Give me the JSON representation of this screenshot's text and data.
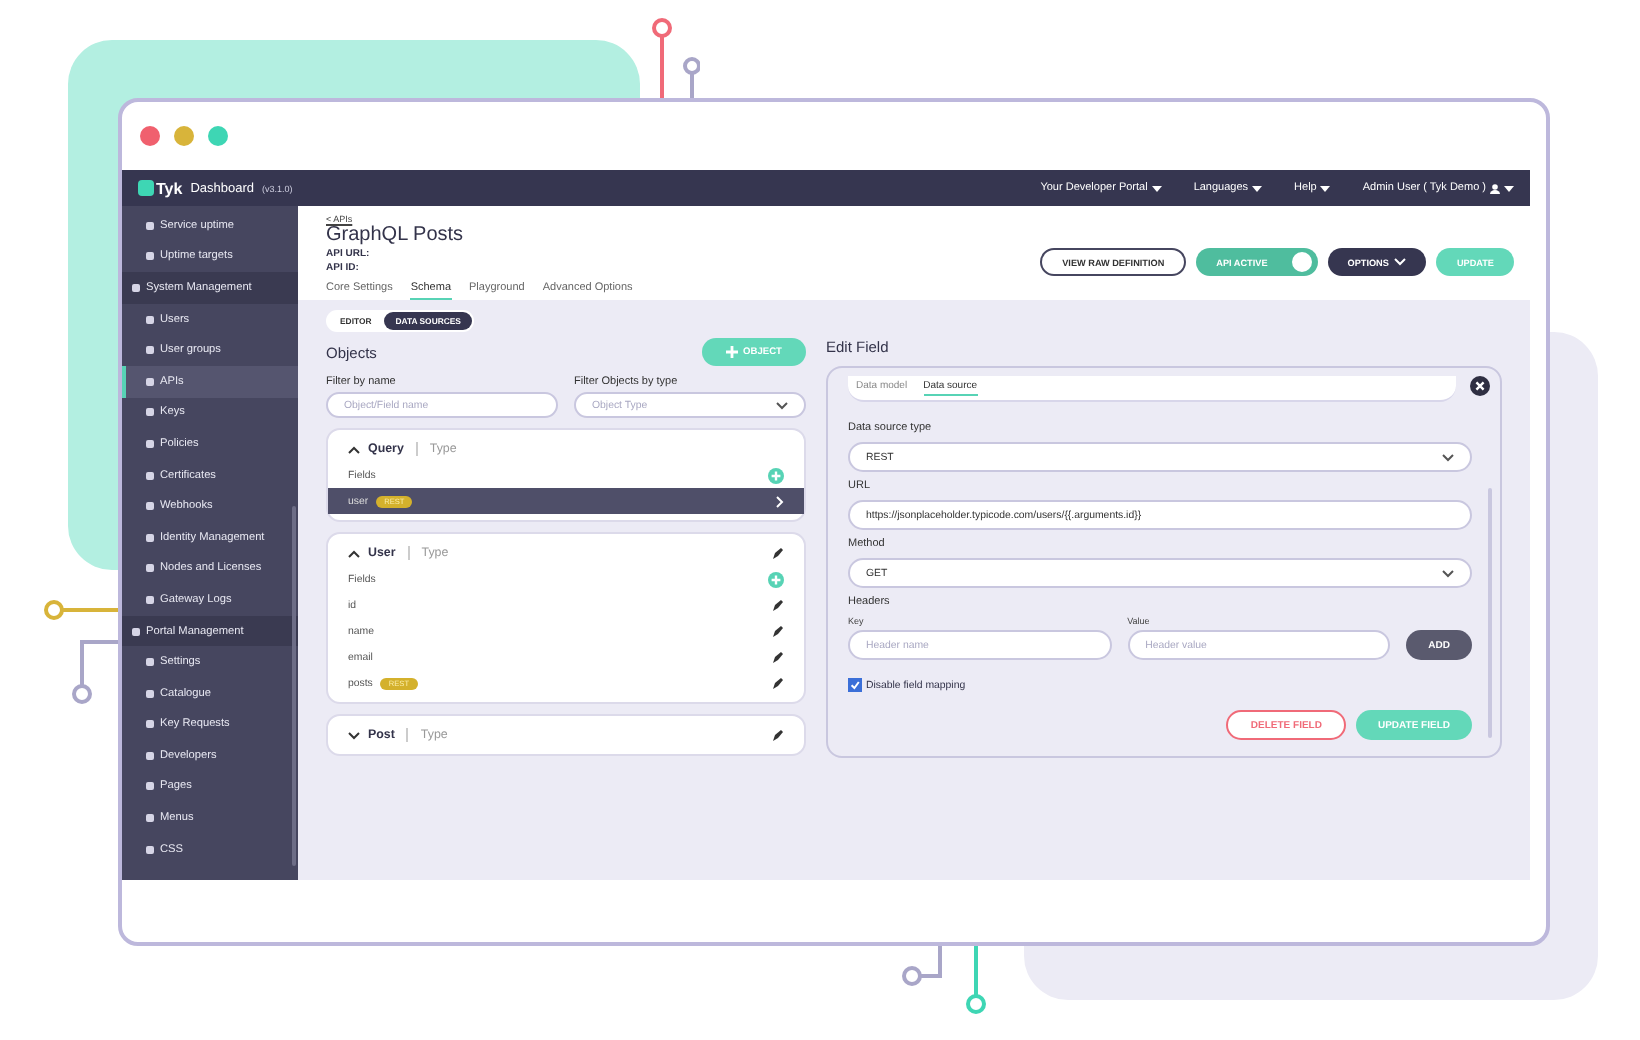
{
  "browser": {
    "dots": [
      {
        "color": "#f0606e"
      },
      {
        "color": "#d8b43a"
      },
      {
        "color": "#3ed6b4"
      }
    ]
  },
  "topbar": {
    "logo": "Tyk",
    "product": "Dashboard",
    "version": "(v3.1.0)",
    "menus": [
      {
        "label": "Your Developer Portal"
      },
      {
        "label": "Languages"
      },
      {
        "label": "Help"
      }
    ],
    "user": "Admin User ( Tyk Demo )"
  },
  "sidebar": {
    "items": [
      {
        "label": "Service uptime",
        "kind": "item",
        "selected": false
      },
      {
        "label": "Uptime targets",
        "kind": "item",
        "selected": false
      },
      {
        "label": "System Management",
        "kind": "section",
        "selected": false
      },
      {
        "label": "Users",
        "kind": "item",
        "selected": false
      },
      {
        "label": "User groups",
        "kind": "item",
        "selected": false
      },
      {
        "label": "APIs",
        "kind": "item",
        "selected": true
      },
      {
        "label": "Keys",
        "kind": "item",
        "selected": false
      },
      {
        "label": "Policies",
        "kind": "item",
        "selected": false
      },
      {
        "label": "Certificates",
        "kind": "item",
        "selected": false
      },
      {
        "label": "Webhooks",
        "kind": "item",
        "selected": false
      },
      {
        "label": "Identity Management",
        "kind": "item",
        "selected": false
      },
      {
        "label": "Nodes and Licenses",
        "kind": "item",
        "selected": false
      },
      {
        "label": "Gateway Logs",
        "kind": "item",
        "selected": false
      },
      {
        "label": "Portal Management",
        "kind": "section",
        "selected": false
      },
      {
        "label": "Settings",
        "kind": "item",
        "selected": false
      },
      {
        "label": "Catalogue",
        "kind": "item",
        "selected": false
      },
      {
        "label": "Key Requests",
        "kind": "item",
        "selected": false
      },
      {
        "label": "Developers",
        "kind": "item",
        "selected": false
      },
      {
        "label": "Pages",
        "kind": "item",
        "selected": false
      },
      {
        "label": "Menus",
        "kind": "item",
        "selected": false
      },
      {
        "label": "CSS",
        "kind": "item",
        "selected": false
      }
    ]
  },
  "header": {
    "back": "< APIs",
    "title": "GraphQL Posts",
    "api_url": "API URL:",
    "api_id": "API ID:",
    "tabs": [
      {
        "label": "Core Settings",
        "selected": false
      },
      {
        "label": "Schema",
        "selected": true
      },
      {
        "label": "Playground",
        "selected": false
      },
      {
        "label": "Advanced Options",
        "selected": false
      }
    ],
    "view_raw": "VIEW RAW DEFINITION",
    "toggle": {
      "label": "API ACTIVE",
      "on": true
    },
    "options": "OPTIONS",
    "update": "UPDATE"
  },
  "mode": [
    {
      "label": "EDITOR",
      "selected": false
    },
    {
      "label": "DATA SOURCES",
      "selected": true
    }
  ],
  "objects": {
    "title": "Objects",
    "add": "OBJECT",
    "filter_name": {
      "label": "Filter by name",
      "placeholder": "Object/Field name"
    },
    "filter_type": {
      "label": "Filter Objects by type",
      "placeholder": "Object Type"
    },
    "cards": [
      {
        "name": "Query",
        "type": "Type",
        "expanded": true,
        "editable": false,
        "fields_label": "Fields",
        "fields": [
          {
            "name": "user",
            "badge": "REST",
            "selected": true
          }
        ]
      },
      {
        "name": "User",
        "type": "Type",
        "expanded": true,
        "editable": true,
        "fields_label": "Fields",
        "fields": [
          {
            "name": "id",
            "selected": false
          },
          {
            "name": "name",
            "selected": false
          },
          {
            "name": "email",
            "selected": false
          },
          {
            "name": "posts",
            "badge": "REST",
            "selected": false
          }
        ]
      },
      {
        "name": "Post",
        "type": "Type",
        "expanded": false,
        "editable": true
      }
    ]
  },
  "edit": {
    "title": "Edit Field",
    "tabs": [
      {
        "label": "Data model",
        "selected": false
      },
      {
        "label": "Data source",
        "selected": true
      }
    ],
    "source_type": {
      "label": "Data source type",
      "value": "REST"
    },
    "url": {
      "label": "URL",
      "value": "https://jsonplaceholder.typicode.com/users/{{.arguments.id}}"
    },
    "method": {
      "label": "Method",
      "value": "GET"
    },
    "headers": {
      "label": "Headers",
      "key_label": "Key",
      "value_label": "Value",
      "key_placeholder": "Header name",
      "value_placeholder": "Header value",
      "add": "ADD"
    },
    "mapping": {
      "label": "Disable field mapping",
      "checked": true
    },
    "delete": "DELETE FIELD",
    "save": "UPDATE FIELD"
  }
}
